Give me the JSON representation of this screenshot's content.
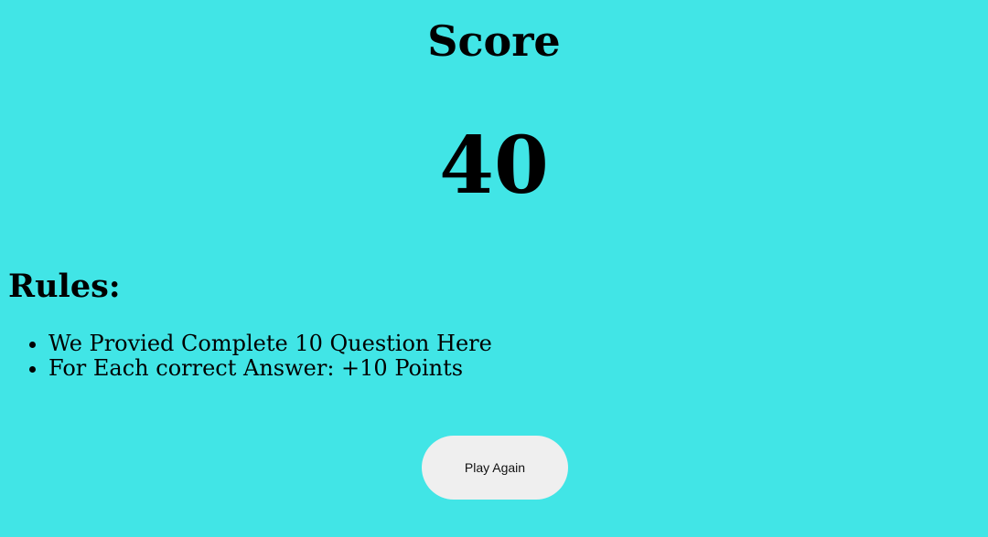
{
  "score": {
    "title": "Score",
    "value": "40"
  },
  "rules": {
    "heading": "Rules:",
    "items": [
      "We Provied Complete 10 Question Here",
      "For Each correct Answer: +10 Points"
    ]
  },
  "actions": {
    "play_again_label": "Play Again"
  },
  "colors": {
    "background": "#41e5e6",
    "button_background": "#efefef",
    "text": "#000000"
  }
}
